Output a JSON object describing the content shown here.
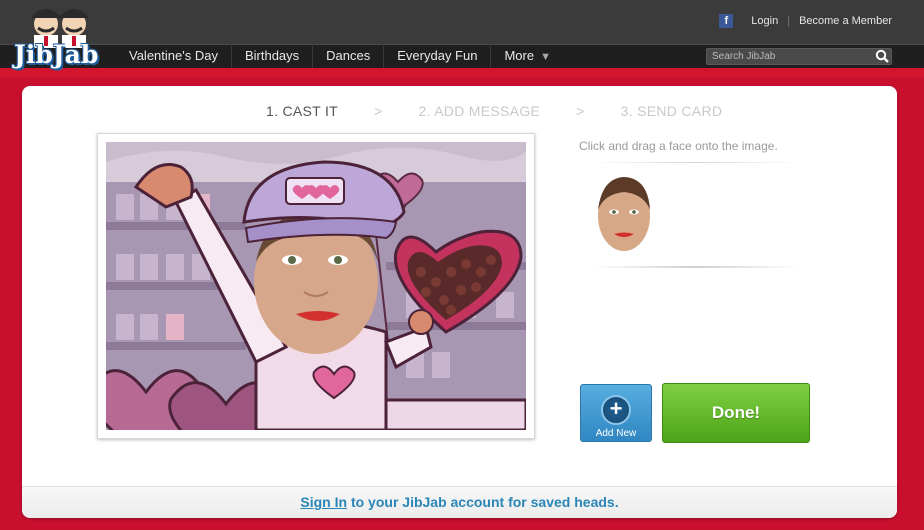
{
  "brand": {
    "logo_text": "JibJab"
  },
  "top_links": {
    "facebook_icon": "facebook-icon",
    "login": "Login",
    "become_member": "Become a Member"
  },
  "nav": {
    "items": [
      "Valentine's Day",
      "Birthdays",
      "Dances",
      "Everyday Fun"
    ],
    "more_label": "More",
    "search_placeholder": "Search JibJab"
  },
  "steps": {
    "step1": "1. CAST IT",
    "sep1": ">",
    "step2": "2. ADD MESSAGE",
    "sep2": ">",
    "step3": "3. SEND CARD"
  },
  "instruction": "Click and drag a face onto the image.",
  "buttons": {
    "add_new": "Add New",
    "done": "Done!"
  },
  "footer": {
    "sign_in": "Sign In",
    "rest": " to your JibJab account for saved heads."
  },
  "colors": {
    "brand_red": "#c8102e",
    "link_blue": "#2a86b8",
    "done_green": "#5cb51f",
    "add_blue": "#3f94cf"
  }
}
